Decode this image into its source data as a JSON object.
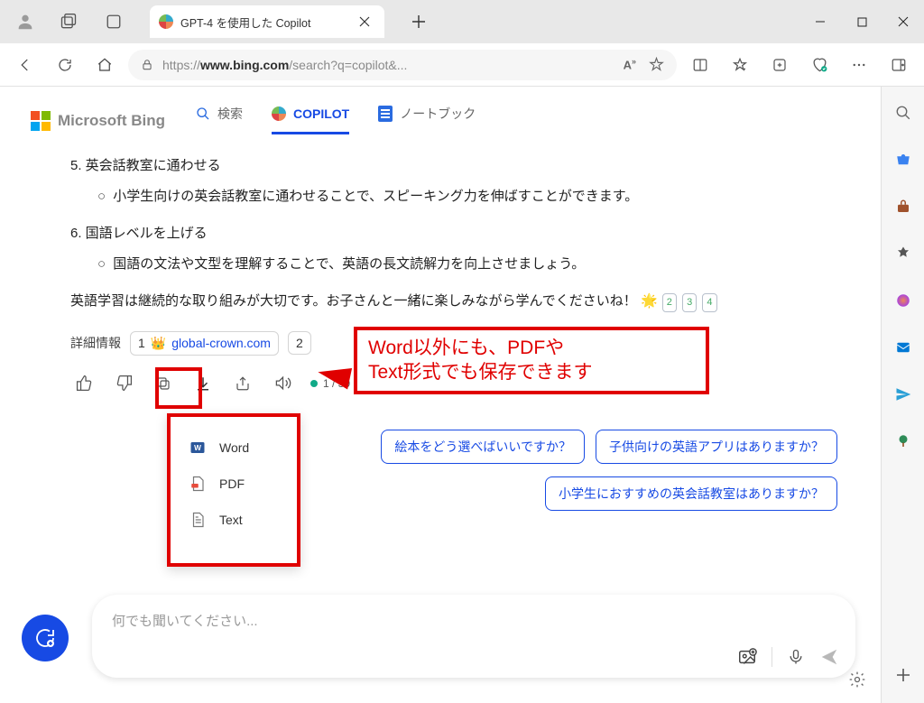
{
  "browser": {
    "tab_title": "GPT-4 を使用した Copilot",
    "url_prefix": "https://",
    "url_host": "www.bing.com",
    "url_path": "/search?q=copilot&..."
  },
  "bing": {
    "logo_text": "Microsoft Bing",
    "tabs": {
      "search": "検索",
      "copilot": "COPILOT",
      "notebook": "ノートブック"
    }
  },
  "answer": {
    "item5_title": "5. 英会話教室に通わせる",
    "item5_detail": "小学生向けの英会話教室に通わせることで、スピーキング力を伸ばすことができます。",
    "item6_title": "6. 国語レベルを上げる",
    "item6_detail": "国語の文法や文型を理解することで、英語の長文読解力を向上させましょう。",
    "closing": "英語学習は継続的な取り組みが大切です。お子さんと一緒に楽しみながら学んでくださいね！",
    "citations": [
      "2",
      "3",
      "4"
    ]
  },
  "sources": {
    "label": "詳細情報",
    "items": [
      {
        "num": "1",
        "domain": "global-crown.com"
      },
      {
        "num": "2",
        "domain": ""
      }
    ]
  },
  "pager": {
    "text": "1 / 30"
  },
  "export_menu": {
    "word": "Word",
    "pdf": "PDF",
    "text": "Text"
  },
  "callout": {
    "line1": "Word以外にも、PDFや",
    "line2": "Text形式でも保存できます"
  },
  "suggestions": {
    "s1": "絵本をどう選べばいいですか？",
    "s2": "子供向けの英語アプリはありますか？",
    "s3": "小学生におすすめの英会話教室はありますか？"
  },
  "input": {
    "placeholder": "何でも聞いてください..."
  }
}
